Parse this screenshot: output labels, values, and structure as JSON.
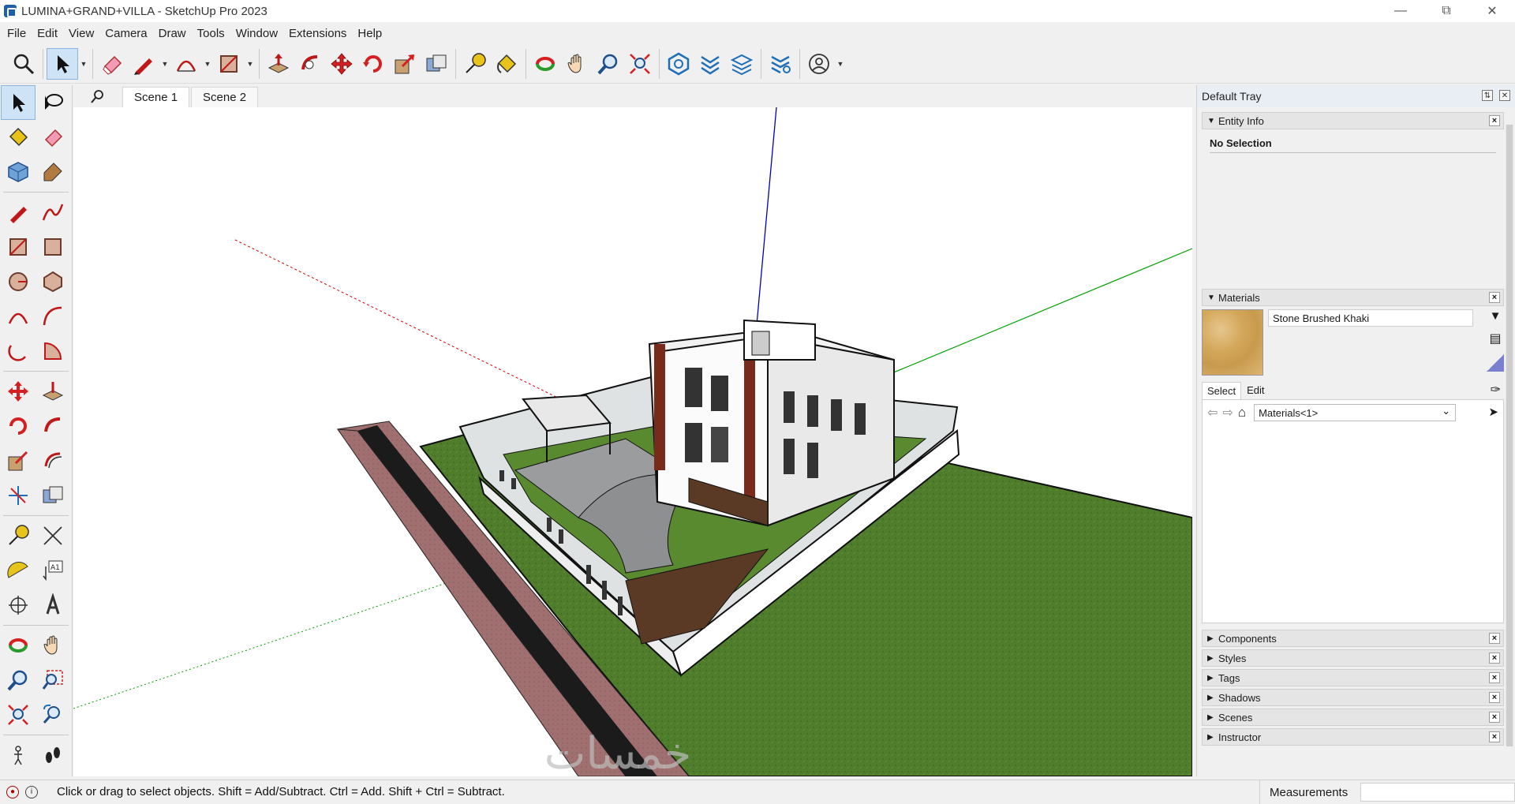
{
  "window": {
    "title": "LUMINA+GRAND+VILLA - SketchUp Pro 2023",
    "controls": [
      "minimize-icon",
      "restore-icon",
      "close-icon"
    ]
  },
  "menu": [
    "File",
    "Edit",
    "View",
    "Camera",
    "Draw",
    "Tools",
    "Window",
    "Extensions",
    "Help"
  ],
  "toolbar": {
    "icons": [
      "search-icon",
      "select-icon",
      "eraser-icon",
      "pencil-line-icon",
      "arc-icon",
      "rectangle-icon",
      "push-pull-icon",
      "follow-me-icon",
      "move-icon",
      "rotate-icon",
      "scale-icon",
      "offset-icon",
      "tape-measure-icon",
      "paint-bucket-icon",
      "orbit-icon",
      "pan-icon",
      "zoom-icon",
      "zoom-extents-icon",
      "warehouse-icon",
      "extension-warehouse-icon",
      "layout-icon",
      "extension-manager-icon",
      "account-icon"
    ]
  },
  "scenes": {
    "tabs": [
      "Scene 1",
      "Scene 2"
    ]
  },
  "tray": {
    "title": "Default Tray",
    "entity_info": {
      "title": "Entity Info",
      "status": "No Selection"
    },
    "materials": {
      "title": "Materials",
      "name": "Stone Brushed Khaki",
      "tabs": [
        "Select",
        "Edit"
      ],
      "collection": "Materials<1>",
      "swatch_color": "#d4a85b"
    },
    "collapsed_panels": [
      "Components",
      "Styles",
      "Tags",
      "Shadows",
      "Scenes",
      "Instructor"
    ]
  },
  "status": {
    "hint": "Click or drag to select objects. Shift = Add/Subtract. Ctrl = Add. Shift + Ctrl = Subtract.",
    "measurements_label": "Measurements",
    "measurements_value": ""
  },
  "watermark": "خمسات",
  "colors": {
    "accent": "#cfe3f7",
    "red_axis": "#d00000",
    "green_axis": "#00a000",
    "blue_axis": "#0000c0",
    "grass": "#4a7a2a"
  }
}
